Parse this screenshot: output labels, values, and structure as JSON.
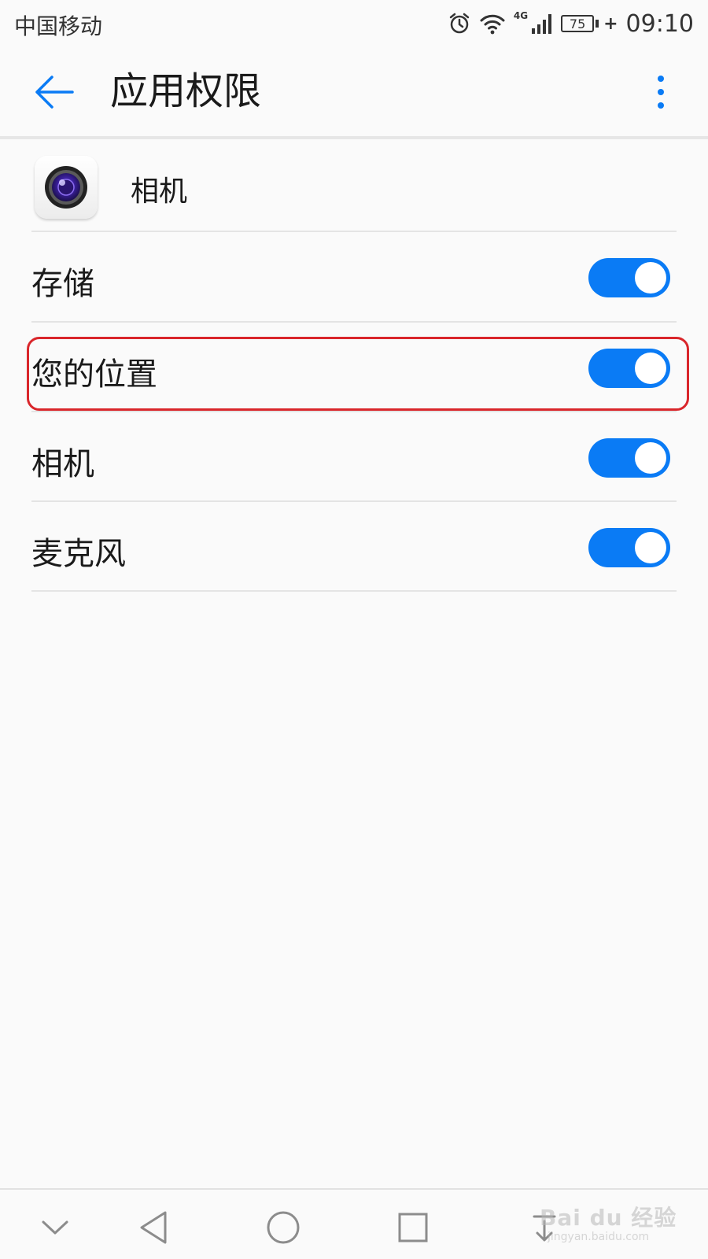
{
  "status_bar": {
    "carrier": "中国移动",
    "network": "4G",
    "battery": "75",
    "time": "09:10"
  },
  "app_bar": {
    "title": "应用权限"
  },
  "app": {
    "name": "相机"
  },
  "permissions": [
    {
      "label": "存储",
      "enabled": true
    },
    {
      "label": "您的位置",
      "enabled": true,
      "highlighted": true
    },
    {
      "label": "相机",
      "enabled": true
    },
    {
      "label": "麦克风",
      "enabled": true
    }
  ],
  "colors": {
    "accent": "#0a7bf5",
    "highlight_border": "#d9262b"
  },
  "watermark": {
    "main": "Bai du 经验",
    "sub": "jingyan.baidu.com"
  }
}
